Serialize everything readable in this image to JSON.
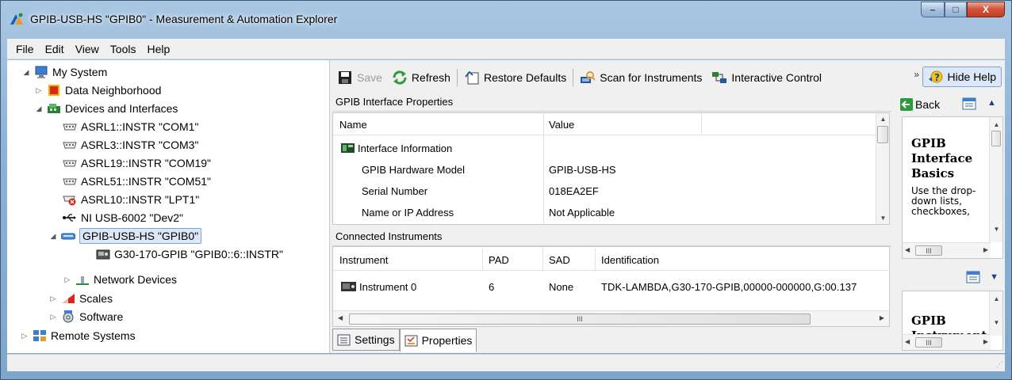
{
  "window": {
    "title": "GPIB-USB-HS \"GPIB0\" - Measurement & Automation Explorer",
    "controls": {
      "minimize": "–",
      "maximize": "□",
      "close": "X"
    }
  },
  "menu": [
    "File",
    "Edit",
    "View",
    "Tools",
    "Help"
  ],
  "tree": {
    "items": [
      {
        "label": "My System",
        "expander": "◢",
        "icon": "computer-icon"
      },
      {
        "label": "Data Neighborhood",
        "expander": "▷",
        "icon": "data-neighborhood-icon"
      },
      {
        "label": "Devices and Interfaces",
        "expander": "◢",
        "icon": "devices-icon"
      },
      {
        "label": "ASRL1::INSTR \"COM1\"",
        "expander": "",
        "icon": "serial-port-icon"
      },
      {
        "label": "ASRL3::INSTR \"COM3\"",
        "expander": "",
        "icon": "serial-port-icon"
      },
      {
        "label": "ASRL19::INSTR \"COM19\"",
        "expander": "",
        "icon": "serial-port-icon"
      },
      {
        "label": "ASRL51::INSTR \"COM51\"",
        "expander": "",
        "icon": "serial-port-icon"
      },
      {
        "label": "ASRL10::INSTR \"LPT1\"",
        "expander": "",
        "icon": "parallel-port-error-icon"
      },
      {
        "label": "NI USB-6002 \"Dev2\"",
        "expander": "",
        "icon": "usb-icon"
      },
      {
        "label": "GPIB-USB-HS \"GPIB0\"",
        "expander": "◢",
        "icon": "gpib-icon",
        "selected": true
      },
      {
        "label": "G30-170-GPIB \"GPIB0::6::INSTR\"",
        "expander": "",
        "icon": "instrument-icon"
      },
      {
        "label": "Network Devices",
        "expander": "▷",
        "icon": "network-devices-icon"
      },
      {
        "label": "Scales",
        "expander": "▷",
        "icon": "scales-icon"
      },
      {
        "label": "Software",
        "expander": "▷",
        "icon": "software-icon"
      },
      {
        "label": "Remote Systems",
        "expander": "▷",
        "icon": "remote-systems-icon"
      }
    ]
  },
  "toolbar": {
    "save": "Save",
    "refresh": "Refresh",
    "restore_defaults": "Restore Defaults",
    "scan": "Scan for Instruments",
    "interactive_control": "Interactive Control",
    "overflow": "»",
    "hide_help": "Hide Help"
  },
  "interface_properties": {
    "header": "GPIB Interface Properties",
    "columns": [
      "Name",
      "Value"
    ],
    "rows": [
      {
        "name": "Interface Information",
        "value": ""
      },
      {
        "name": "GPIB Hardware Model",
        "value": "GPIB-USB-HS"
      },
      {
        "name": "Serial Number",
        "value": "018EA2EF"
      },
      {
        "name": "Name or IP Address",
        "value": "Not Applicable"
      }
    ]
  },
  "connected_instruments": {
    "header": "Connected Instruments",
    "columns": [
      "Instrument",
      "PAD",
      "SAD",
      "Identification"
    ],
    "rows": [
      {
        "instrument": "Instrument 0",
        "pad": "6",
        "sad": "None",
        "identification": "TDK-LAMBDA,G30-170-GPIB,00000-000000,G:00.137"
      }
    ],
    "hscroll_mark": "III"
  },
  "tabs": [
    {
      "label": "Settings",
      "active": false
    },
    {
      "label": "Properties",
      "active": true
    }
  ],
  "help": {
    "back": "Back",
    "topic1": {
      "title": "GPIB Interface Basics",
      "text": "Use the drop-down lists, checkboxes,"
    },
    "topic2": {
      "title": "GPIB Instrument"
    },
    "scroll_mark": "III"
  }
}
